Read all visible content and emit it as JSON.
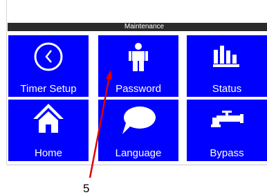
{
  "screen": {
    "title": "Maintenance",
    "colors": {
      "tile_bg": "#0000ff",
      "tile_text": "#ffffff",
      "titlebar_bg": "#2b2b2b"
    },
    "tiles": [
      {
        "label": "Timer Setup",
        "icon": "clock-icon"
      },
      {
        "label": "Password",
        "icon": "person-icon"
      },
      {
        "label": "Status",
        "icon": "bar-chart-icon"
      },
      {
        "label": "Home",
        "icon": "house-icon"
      },
      {
        "label": "Language",
        "icon": "speech-bubble-icon"
      },
      {
        "label": "Bypass",
        "icon": "valve-pipe-icon"
      }
    ]
  },
  "annotation": {
    "callout_number": "5",
    "arrow_color": "#e00000"
  }
}
